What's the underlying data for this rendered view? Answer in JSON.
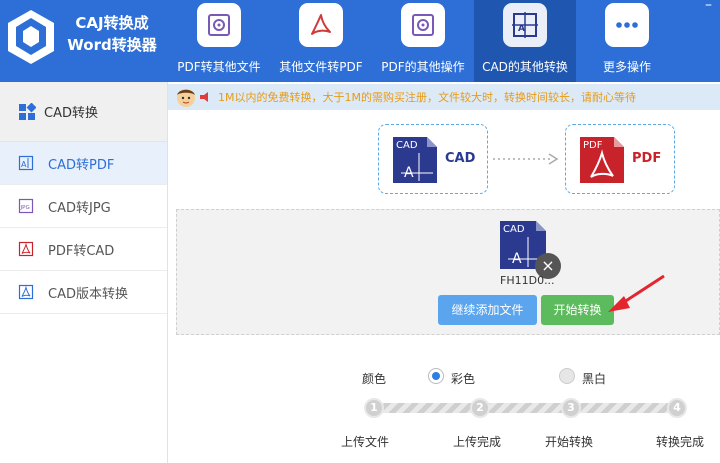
{
  "app": {
    "title_line1": "CAJ转换成",
    "title_line2": "Word转换器",
    "minimize": "–"
  },
  "nav": [
    {
      "label": "PDF转其他文件",
      "icon": "settings-doc-icon",
      "active": false
    },
    {
      "label": "其他文件转PDF",
      "icon": "pdf-icon",
      "active": false
    },
    {
      "label": "PDF的其他操作",
      "icon": "settings-doc-icon",
      "active": false
    },
    {
      "label": "CAD的其他转换",
      "icon": "cad-icon",
      "active": true
    },
    {
      "label": "更多操作",
      "icon": "more-dots-icon",
      "active": false
    }
  ],
  "sidebar": {
    "header": "CAD转换",
    "items": [
      {
        "label": "CAD转PDF",
        "active": true
      },
      {
        "label": "CAD转JPG",
        "active": false
      },
      {
        "label": "PDF转CAD",
        "active": false
      },
      {
        "label": "CAD版本转换",
        "active": false
      }
    ]
  },
  "notice": "1M以内的免费转换，大于1M的需购买注册，文件较大时，转换时间较长，请耐心等待",
  "conversion": {
    "from_label": "CAD",
    "from_icon_text": "CAD",
    "to_label": "PDF",
    "to_icon_text": "PDF"
  },
  "file": {
    "name": "FH11D0...",
    "icon_text": "CAD",
    "close": "×"
  },
  "buttons": {
    "add": "继续添加文件",
    "start": "开始转换"
  },
  "options": {
    "label": "颜色",
    "color": "彩色",
    "bw": "黑白",
    "selected": "color"
  },
  "steps": [
    {
      "num": "1",
      "label": "上传文件"
    },
    {
      "num": "2",
      "label": "上传完成"
    },
    {
      "num": "3",
      "label": "开始转换"
    },
    {
      "num": "4",
      "label": "转换完成"
    }
  ],
  "colors": {
    "header": "#2d6fd6",
    "active_nav": "#1f56b0",
    "accent": "#2d6fd6",
    "cad_icon": "#2b3a8f",
    "pdf_icon": "#c8232b",
    "notice_text": "#e89b14"
  }
}
